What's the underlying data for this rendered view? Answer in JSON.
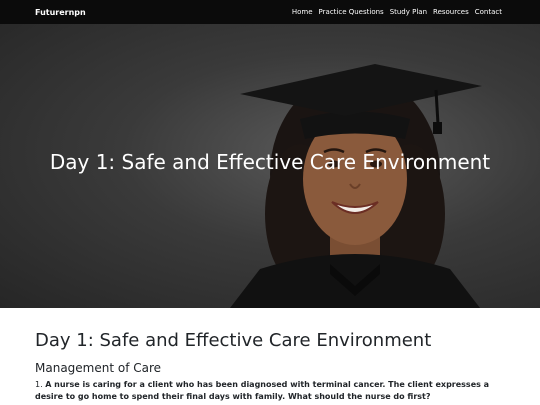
{
  "nav": {
    "brand": "Futurernpn",
    "links": [
      "Home",
      "Practice Questions",
      "Study Plan",
      "Resources",
      "Contact"
    ]
  },
  "hero": {
    "title": "Day 1: Safe and Effective Care Environment",
    "image_description_colors": {
      "background": "#3a3a3a",
      "cap": "#121212",
      "skin": "#8a5a3c",
      "hair": "#1a1412"
    }
  },
  "main": {
    "title": "Day 1: Safe and Effective Care Environment",
    "section": "Management of Care",
    "question": {
      "number": "1.",
      "text": "A nurse is caring for a client who has been diagnosed with terminal cancer. The client expresses a desire to go home to spend their final days with family. What should the nurse do first?"
    }
  }
}
